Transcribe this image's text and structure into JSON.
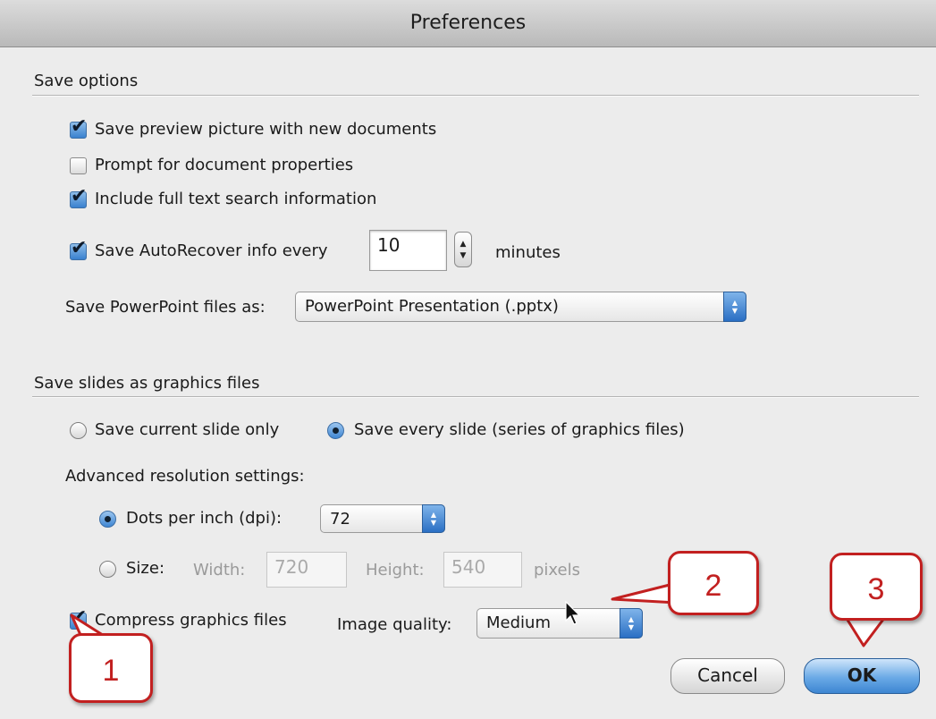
{
  "window": {
    "title": "Preferences"
  },
  "save_options": {
    "heading": "Save options",
    "preview_picture": {
      "label": "Save preview picture with new documents",
      "checked": true
    },
    "prompt_properties": {
      "label": "Prompt for document properties",
      "checked": false
    },
    "full_text_search": {
      "label": "Include full text search information",
      "checked": true
    },
    "autorecover": {
      "label": "Save AutoRecover info every",
      "checked": true,
      "value": "10",
      "unit": "minutes"
    },
    "file_format": {
      "label": "Save PowerPoint files as:",
      "selected": "PowerPoint Presentation (.pptx)"
    }
  },
  "graphics": {
    "heading": "Save slides as graphics files",
    "current_slide": {
      "label": "Save current slide only",
      "selected": false
    },
    "every_slide": {
      "label": "Save every slide (series of graphics files)",
      "selected": true
    },
    "advanced_label": "Advanced resolution settings:",
    "dpi": {
      "label": "Dots per inch (dpi):",
      "selected_option": true,
      "value": "72"
    },
    "size": {
      "label": "Size:",
      "width_label": "Width:",
      "width": "720",
      "height_label": "Height:",
      "height": "540",
      "unit": "pixels"
    },
    "compress": {
      "label": "Compress graphics files",
      "checked": true
    },
    "quality": {
      "label": "Image quality:",
      "selected": "Medium"
    }
  },
  "buttons": {
    "cancel": "Cancel",
    "ok": "OK"
  },
  "callouts": [
    "1",
    "2",
    "3"
  ],
  "colors": {
    "accent": "#3d86d2",
    "callout": "#c22020"
  },
  "icons": [
    "checkmark-icon",
    "radio-dot-icon",
    "stepper-icon",
    "select-arrows-icon",
    "mouse-pointer-icon"
  ]
}
